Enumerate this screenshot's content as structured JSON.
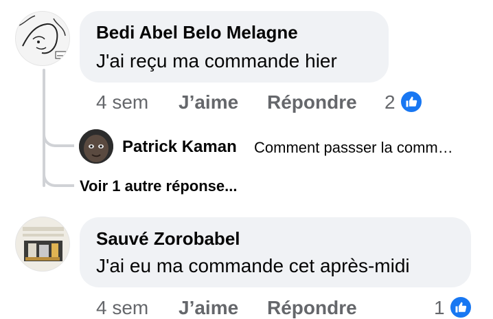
{
  "comments": [
    {
      "author": "Bedi Abel Belo Melagne",
      "text": "J'ai reçu ma commande hier",
      "time": "4 sem",
      "like_label": "J’aime",
      "reply_label": "Répondre",
      "reaction_count": "2",
      "avatar_icon": "sketch-portrait-avatar",
      "replies_preview": {
        "author": "Patrick Kaman",
        "text": "Comment passser la comm…",
        "more_label": "Voir 1 autre réponse..."
      }
    },
    {
      "author": "Sauvé Zorobabel",
      "text": "J'ai eu ma commande cet après-midi",
      "time": "4 sem",
      "like_label": "J’aime",
      "reply_label": "Répondre",
      "reaction_count": "1",
      "avatar_icon": "product-photo-avatar"
    }
  ],
  "colors": {
    "bubble_bg": "#f0f2f5",
    "meta_text": "#65676b",
    "like_blue": "#1877f2",
    "thread_line": "#d0d2d6"
  }
}
